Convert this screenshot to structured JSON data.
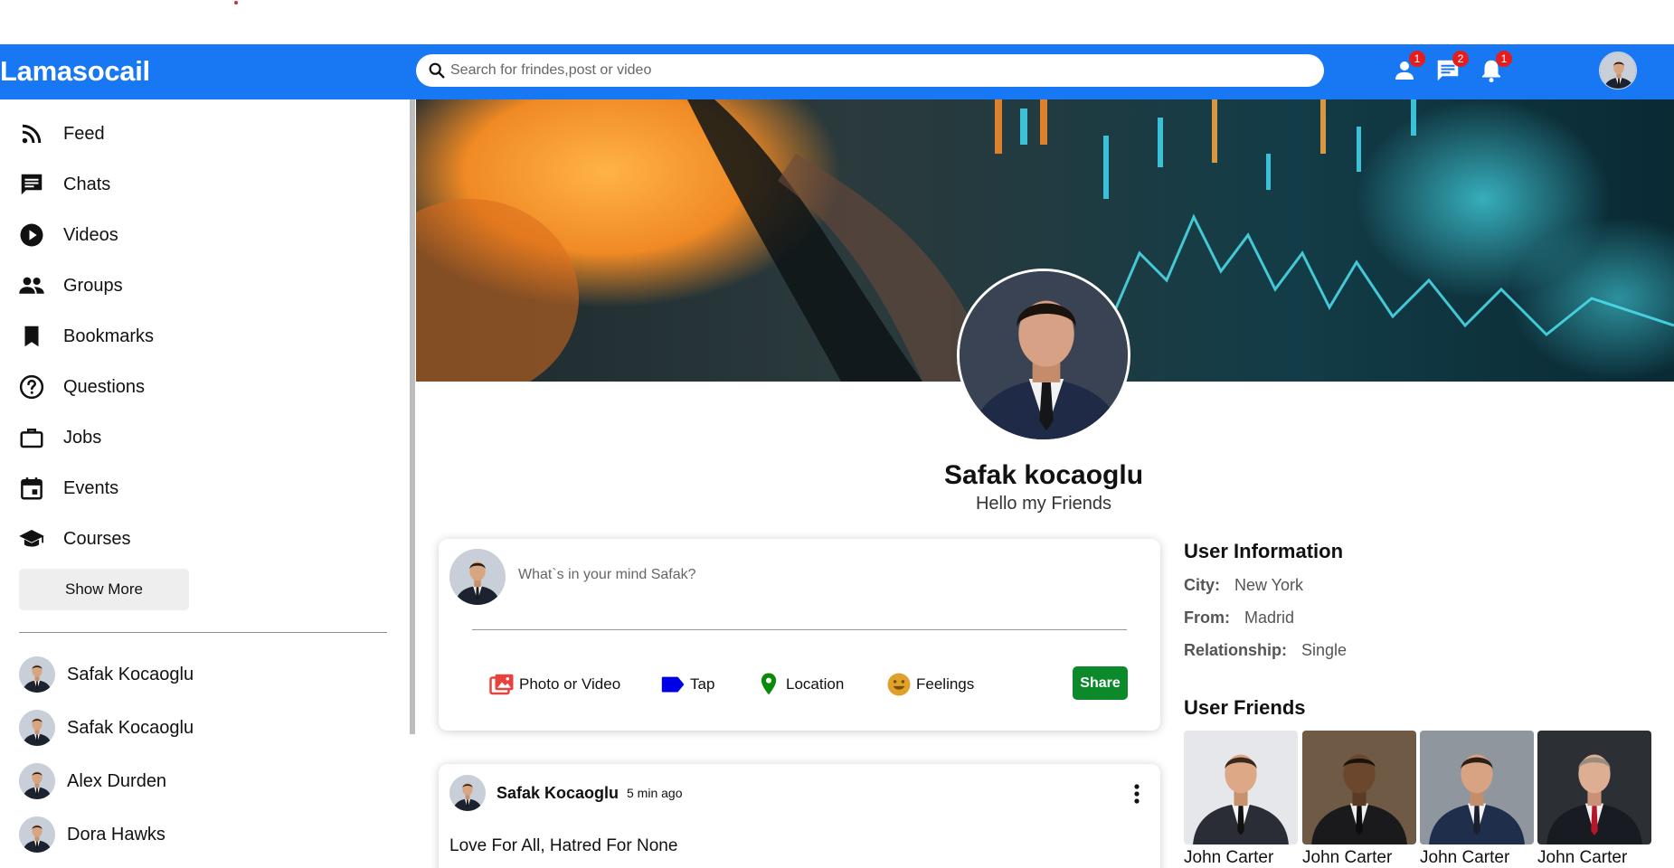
{
  "app": {
    "logo": "Lamasocail"
  },
  "search": {
    "placeholder": "Search for frindes,post or video"
  },
  "topbar_icons": [
    {
      "icon": "person-icon",
      "badge": "1"
    },
    {
      "icon": "chat-icon",
      "badge": "2"
    },
    {
      "icon": "bell-icon",
      "badge": "1"
    }
  ],
  "sidebar": {
    "items": [
      {
        "icon": "rss-feed-icon",
        "label": "Feed"
      },
      {
        "icon": "chat-icon",
        "label": "Chats"
      },
      {
        "icon": "play-circle-icon",
        "label": "Videos"
      },
      {
        "icon": "group-icon",
        "label": "Groups"
      },
      {
        "icon": "bookmark-icon",
        "label": "Bookmarks"
      },
      {
        "icon": "help-circle-icon",
        "label": "Questions"
      },
      {
        "icon": "briefcase-icon",
        "label": "Jobs"
      },
      {
        "icon": "calendar-icon",
        "label": "Events"
      },
      {
        "icon": "school-icon",
        "label": "Courses"
      }
    ],
    "show_more": "Show More",
    "friends": [
      {
        "name": "Safak Kocaoglu"
      },
      {
        "name": "Safak Kocaoglu"
      },
      {
        "name": "Alex Durden"
      },
      {
        "name": "Dora Hawks"
      }
    ]
  },
  "profile": {
    "name": "Safak kocaoglu",
    "description": "Hello my Friends"
  },
  "share": {
    "placeholder": "What`s in your mind Safak?",
    "options": [
      {
        "icon": "photo-icon",
        "label": "Photo or Video",
        "color": "#e8423f"
      },
      {
        "icon": "label-icon",
        "label": "Tap",
        "color": "#0000e6"
      },
      {
        "icon": "location-pin-icon",
        "label": "Location",
        "color": "#0a8a0a"
      },
      {
        "icon": "smiley-icon",
        "label": "Feelings",
        "color": "#e0a12a"
      }
    ],
    "share_button": "Share"
  },
  "post": {
    "username": "Safak Kocaoglu",
    "time": "5 min ago",
    "text": "Love For All, Hatred For None"
  },
  "user_info": {
    "title": "User Information",
    "rows": [
      {
        "key": "City:",
        "value": "New York"
      },
      {
        "key": "From:",
        "value": "Madrid"
      },
      {
        "key": "Relationship:",
        "value": "Single"
      }
    ]
  },
  "user_friends": {
    "title": "User Friends",
    "items": [
      {
        "name": "John Carter"
      },
      {
        "name": "John Carter"
      },
      {
        "name": "John Carter"
      },
      {
        "name": "John Carter"
      }
    ]
  },
  "colors": {
    "brand": "#1877f2",
    "badge": "#e41e1e",
    "share_button": "#0c8a2b"
  }
}
